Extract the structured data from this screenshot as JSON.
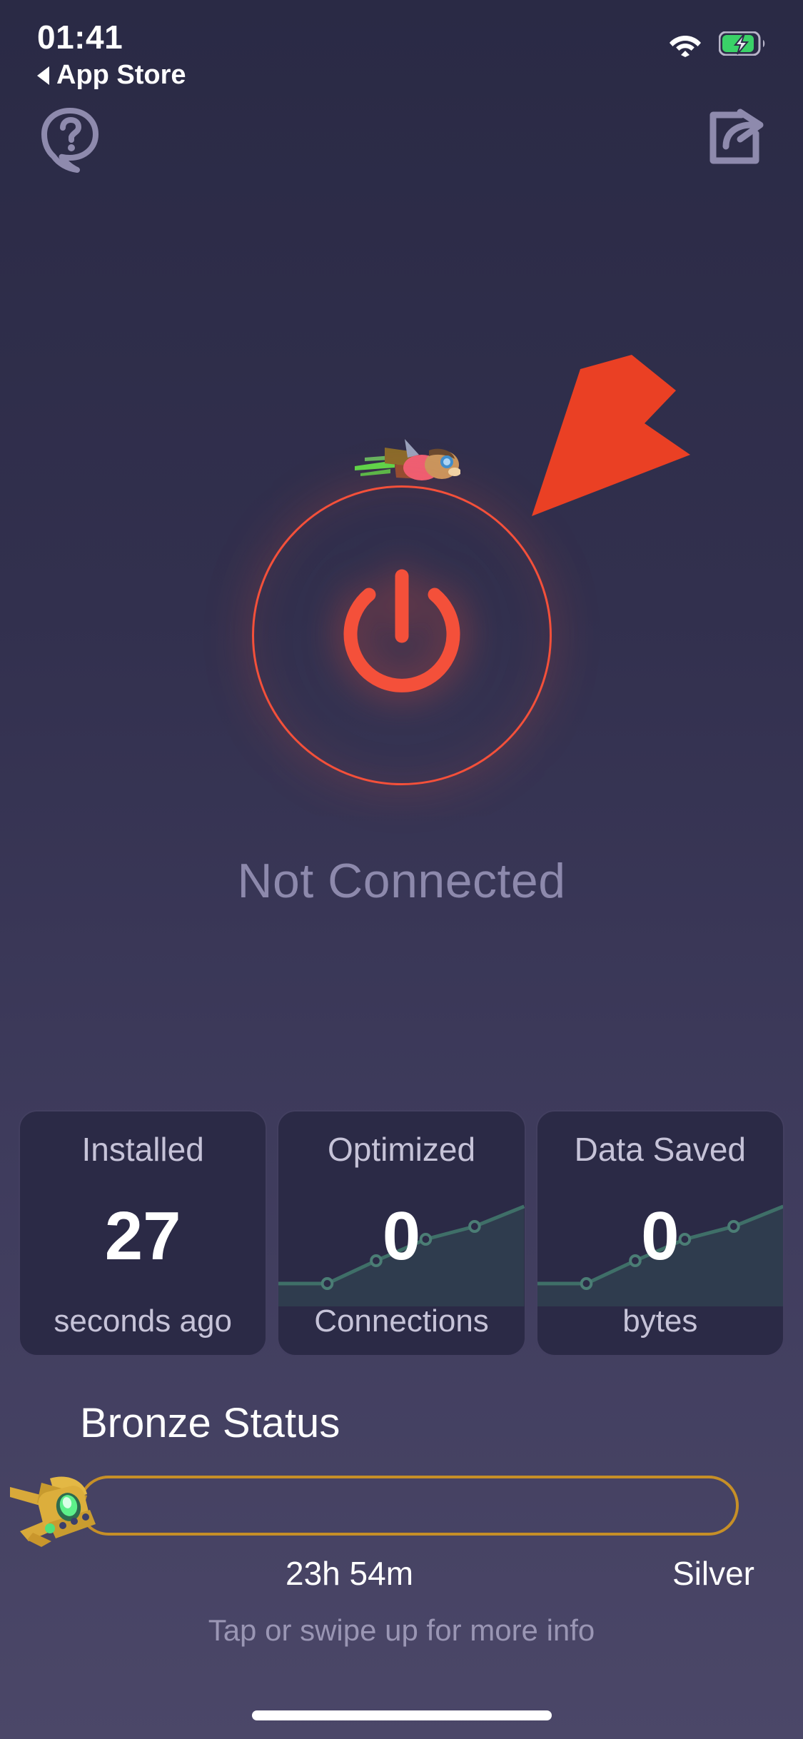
{
  "status_bar": {
    "clock": "01:41",
    "back_label": "App Store",
    "back_caret_icon": "caret-left-icon",
    "wifi_icon": "wifi-icon",
    "battery_icon": "battery-charging-icon"
  },
  "header": {
    "help_icon": "help-question-bubble-icon",
    "share_icon": "share-box-arrow-icon"
  },
  "hero": {
    "power_icon": "power-button-icon",
    "rocket_icon": "flying-rocket-character-icon",
    "connection_status": "Not Connected",
    "annotation_arrow_icon": "red-pointer-arrow-icon",
    "accent_color": "#f4503a"
  },
  "stats": {
    "cards": [
      {
        "title": "Installed",
        "value": "27",
        "unit": "seconds ago",
        "has_sparkline": false
      },
      {
        "title": "Optimized",
        "value": "0",
        "unit": "Connections",
        "has_sparkline": true
      },
      {
        "title": "Data Saved",
        "value": "0",
        "unit": "bytes",
        "has_sparkline": true
      }
    ]
  },
  "status_section": {
    "tier_title": "Bronze Status",
    "badge_icon": "bronze-rocket-badge-icon",
    "progress_percent": 0,
    "elapsed_label": "23h 54m",
    "next_tier_label": "Silver",
    "track_color": "#c68f27"
  },
  "footer": {
    "hint": "Tap or swipe up for more info",
    "home_indicator_icon": "home-indicator-icon"
  },
  "chart_data": {
    "type": "line",
    "title": "",
    "xlabel": "",
    "ylabel": "",
    "grid": false,
    "legend": "none",
    "series": [
      {
        "name": "Optimized",
        "x": [
          0,
          1,
          2,
          3,
          4,
          5
        ],
        "values": [
          10,
          10,
          26,
          44,
          56,
          74
        ]
      },
      {
        "name": "Data Saved",
        "x": [
          0,
          1,
          2,
          3,
          4,
          5
        ],
        "values": [
          10,
          10,
          26,
          44,
          56,
          74
        ]
      }
    ]
  }
}
